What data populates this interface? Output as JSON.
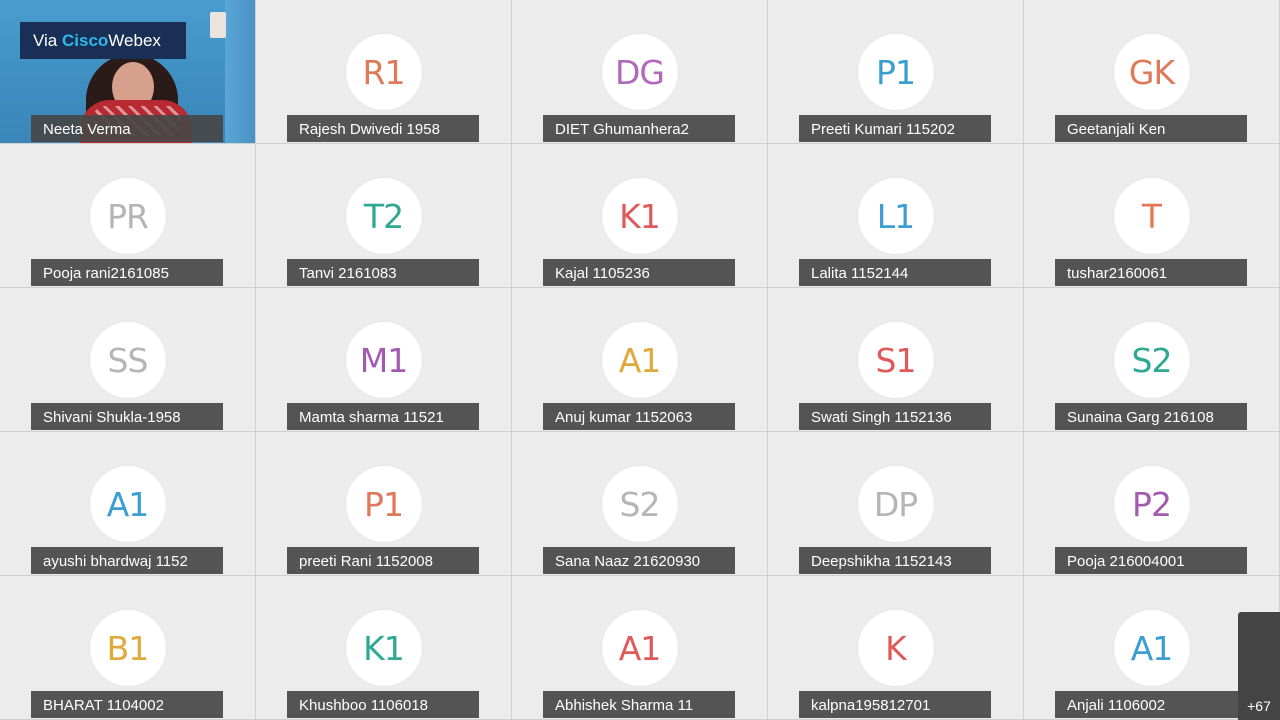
{
  "brand": {
    "prefix": "Via ",
    "accent": "Cisco",
    "suffix": "Webex"
  },
  "video_participant": {
    "name": "Neeta Verma"
  },
  "participants": [
    {
      "initials": "R1",
      "name": "Rajesh Dwivedi 1958",
      "color": "#e0795a"
    },
    {
      "initials": "DG",
      "name": "DIET Ghumanhera2",
      "color": "#b06ab8"
    },
    {
      "initials": "P1",
      "name": "Preeti Kumari 115202",
      "color": "#3a9fd0"
    },
    {
      "initials": "GK",
      "name": "Geetanjali Ken",
      "color": "#e0795a"
    },
    {
      "initials": "PR",
      "name": "Pooja rani2161085",
      "color": "#b5b5b5"
    },
    {
      "initials": "T2",
      "name": "Tanvi 2161083",
      "color": "#2fa894"
    },
    {
      "initials": "K1",
      "name": "Kajal 1105236",
      "color": "#e05a5a"
    },
    {
      "initials": "L1",
      "name": "Lalita 1152144",
      "color": "#3a9fd0"
    },
    {
      "initials": "T",
      "name": "tushar2160061",
      "color": "#e0795a"
    },
    {
      "initials": "SS",
      "name": "Shivani Shukla-1958",
      "color": "#b5b5b5"
    },
    {
      "initials": "M1",
      "name": "Mamta sharma 11521",
      "color": "#a35bb0"
    },
    {
      "initials": "A1",
      "name": "Anuj kumar 1152063",
      "color": "#e0a93a"
    },
    {
      "initials": "S1",
      "name": "Swati Singh 1152136",
      "color": "#e05a5a"
    },
    {
      "initials": "S2",
      "name": "Sunaina Garg 216108",
      "color": "#2fa894"
    },
    {
      "initials": "A1",
      "name": "ayushi bhardwaj 1152",
      "color": "#3a9fd0"
    },
    {
      "initials": "P1",
      "name": "preeti Rani 1152008",
      "color": "#e0795a"
    },
    {
      "initials": "S2",
      "name": "Sana Naaz 21620930",
      "color": "#b5b5b5"
    },
    {
      "initials": "DP",
      "name": "Deepshikha 1152143",
      "color": "#b5b5b5"
    },
    {
      "initials": "P2",
      "name": "Pooja 216004001",
      "color": "#a35bb0"
    },
    {
      "initials": "B1",
      "name": "BHARAT 1104002",
      "color": "#e0a93a"
    },
    {
      "initials": "K1",
      "name": "Khushboo 1106018",
      "color": "#2fa894"
    },
    {
      "initials": "A1",
      "name": "Abhishek Sharma 11",
      "color": "#e05a5a"
    },
    {
      "initials": "K",
      "name": "kalpna195812701",
      "color": "#e05a5a"
    },
    {
      "initials": "A1",
      "name": "Anjali 1106002",
      "color": "#3a9fd0"
    }
  ],
  "overflow": {
    "label": "+67"
  }
}
